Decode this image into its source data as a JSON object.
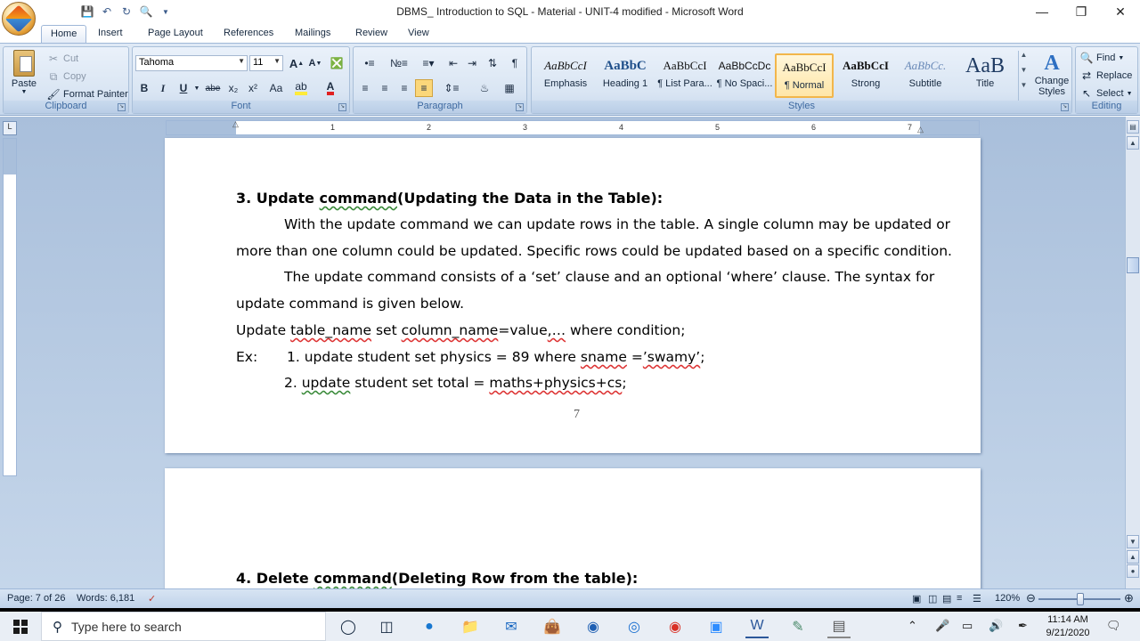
{
  "window": {
    "title": "DBMS_ Introduction to SQL - Material - UNIT-4 modified - Microsoft Word",
    "minimize_icon": "minimize-icon",
    "maximize_icon": "restore-icon",
    "close_icon": "close-icon"
  },
  "tabs": [
    "Home",
    "Insert",
    "Page Layout",
    "References",
    "Mailings",
    "Review",
    "View"
  ],
  "ribbon": {
    "clipboard": {
      "label": "Clipboard",
      "paste": "Paste",
      "cut": "Cut",
      "copy": "Copy",
      "format_painter": "Format Painter"
    },
    "font": {
      "label": "Font",
      "font_name": "Tahoma",
      "font_size": "11",
      "bold": "B",
      "italic": "I",
      "underline": "U",
      "strikethrough": "abe",
      "subscript": "x₂",
      "superscript": "x²",
      "change_case": "Aa",
      "grow": "A",
      "shrink": "A"
    },
    "paragraph": {
      "label": "Paragraph",
      "show_marks": "¶"
    },
    "styles": {
      "label": "Styles",
      "items": [
        {
          "sample": "AaBbCcI",
          "name": "Emphasis"
        },
        {
          "sample": "AaBbC",
          "name": "Heading 1"
        },
        {
          "sample": "AaBbCcI",
          "name": "¶ List Para..."
        },
        {
          "sample": "AaBbCcDc",
          "name": "¶ No Spaci..."
        },
        {
          "sample": "AaBbCcI",
          "name": "¶ Normal"
        },
        {
          "sample": "AaBbCcI",
          "name": "Strong"
        },
        {
          "sample": "AaBbCc.",
          "name": "Subtitle"
        },
        {
          "sample": "AaB",
          "name": "Title"
        }
      ],
      "change_styles": "Change Styles"
    },
    "editing": {
      "label": "Editing",
      "find": "Find",
      "replace": "Replace",
      "select": "Select"
    }
  },
  "ruler": {
    "numbers": [
      "1",
      "2",
      "3",
      "4",
      "5",
      "6",
      "7"
    ]
  },
  "document": {
    "page1": {
      "heading_num": "3. Update ",
      "heading_word": "command",
      "heading_rest": "(Updating the Data in the Table):",
      "p1_line1": "With the update command we can update rows in the table. A single column may be updated or",
      "p1_line2": "more than one column could be updated. Specific rows could be updated based on a specific condition.",
      "p2_line1": "The update command consists of a ‘set’ clause and an optional ‘where’ clause. The syntax for",
      "p2_line2": "update command is given below.",
      "syntax_a": "Update ",
      "syntax_b": "table_name",
      "syntax_c": " set ",
      "syntax_d": "column_name",
      "syntax_e": "=value",
      "syntax_f": ",…",
      "syntax_g": " where condition;",
      "ex_label": "Ex:",
      "ex1_a": "1. update student set physics = 89 where ",
      "ex1_b": "sname",
      "ex1_c": " =",
      "ex1_d": "’swamy’",
      "ex1_e": ";",
      "ex2_a": "2. ",
      "ex2_b": "update",
      "ex2_c": " student set total = ",
      "ex2_d": "maths+physics+cs",
      "ex2_e": ";",
      "page_number": "7"
    },
    "page2": {
      "heading_num": "4. Delete ",
      "heading_word": "command",
      "heading_rest": "(Deleting Row from the table):"
    }
  },
  "statusbar": {
    "page": "Page: 7 of 26",
    "words": "Words: 6,181",
    "zoom": "120%"
  },
  "taskbar": {
    "search_placeholder": "Type here to search",
    "time": "11:14 AM",
    "date": "9/21/2020"
  }
}
